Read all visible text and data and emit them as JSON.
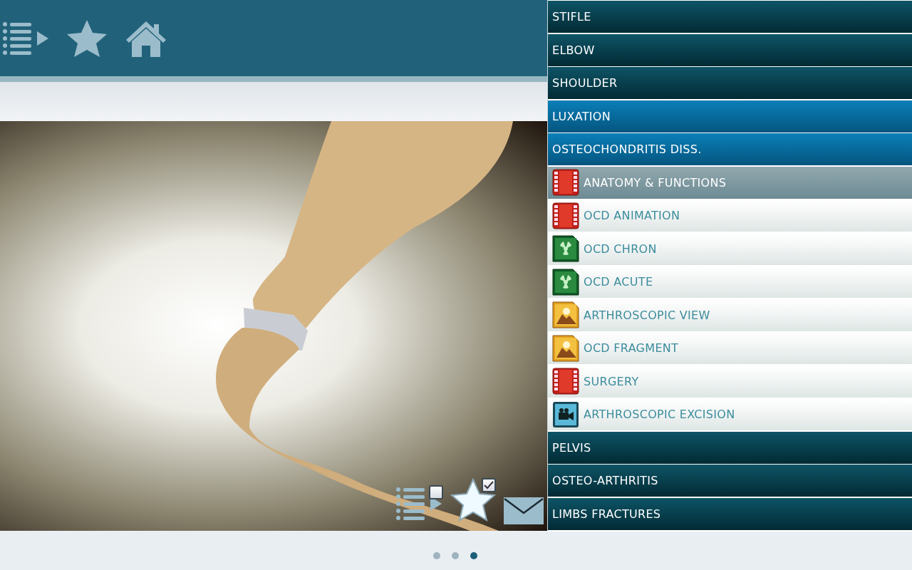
{
  "video": {
    "playlist_checked": false,
    "favorite_checked": true
  },
  "menu": [
    {
      "label": "STIFLE",
      "selected": false
    },
    {
      "label": "ELBOW",
      "selected": false
    },
    {
      "label": "SHOULDER",
      "selected": false
    },
    {
      "label": "LUXATION",
      "selected": true
    },
    {
      "label": "OSTEOCHONDRITIS DISS.",
      "selected": true,
      "children": [
        {
          "label": "ANATOMY & FUNCTIONS",
          "kind": "film",
          "selected": true
        },
        {
          "label": "OCD ANIMATION",
          "kind": "film",
          "selected": false
        },
        {
          "label": "OCD CHRON",
          "kind": "xray",
          "selected": false
        },
        {
          "label": "OCD ACUTE",
          "kind": "xray",
          "selected": false
        },
        {
          "label": "ARTHROSCOPIC VIEW",
          "kind": "image",
          "selected": false
        },
        {
          "label": "OCD FRAGMENT",
          "kind": "image",
          "selected": false
        },
        {
          "label": "SURGERY",
          "kind": "film",
          "selected": false
        },
        {
          "label": "ARTHROSCOPIC EXCISION",
          "kind": "camera",
          "selected": false
        }
      ]
    },
    {
      "label": "PELVIS",
      "selected": false
    },
    {
      "label": "OSTEO-ARTHRITIS",
      "selected": false
    },
    {
      "label": "LIMBS FRACTURES",
      "selected": false
    }
  ],
  "pages": [
    {
      "selected": false
    },
    {
      "selected": false
    },
    {
      "selected": true
    }
  ]
}
